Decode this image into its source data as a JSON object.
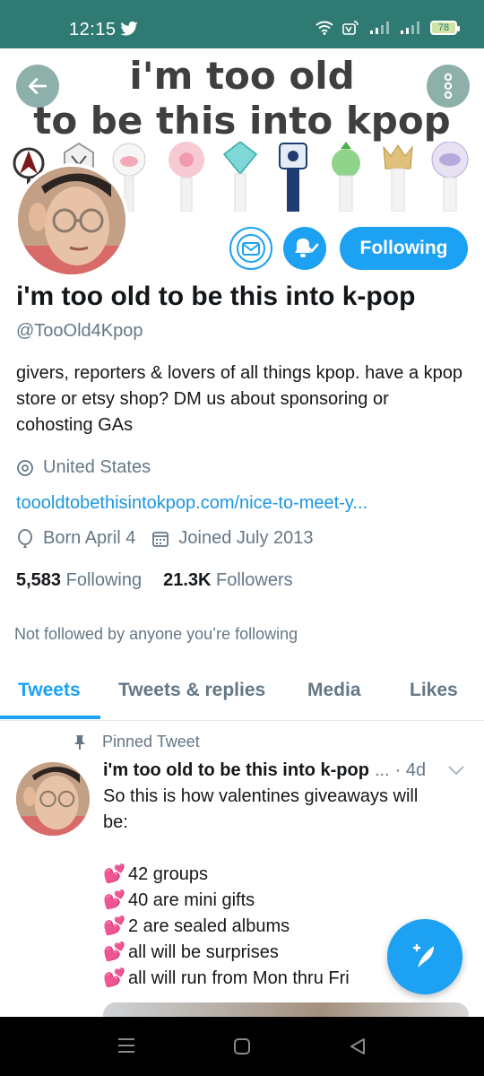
{
  "status_bar": {
    "time": "12:15",
    "battery": "78",
    "icons": [
      "twitter-bird-icon",
      "wifi-icon",
      "volte-icon",
      "signal-icon",
      "signal-icon",
      "battery-icon"
    ]
  },
  "header": {
    "title_line1": "i'm too old",
    "title_line2": "to be this into kpop",
    "back_icon": "arrow-left-icon",
    "more_icon": "more-vertical-icon",
    "lightstick_count": 10
  },
  "profile": {
    "name": "i'm too old to be this into k-pop",
    "handle": "@TooOld4Kpop",
    "bio": "givers, reporters & lovers of all things kpop. have a kpop store or etsy shop? DM us about sponsoring or cohosting GAs",
    "location": "United States",
    "website": "toooldtobethisintokpop.com/nice-to-meet-y...",
    "born": "Born April 4",
    "joined": "Joined July 2013",
    "following_count": "5,583",
    "following_label": "Following",
    "followers_count": "21.3K",
    "followers_label": "Followers",
    "not_followed": "Not followed by anyone you’re following"
  },
  "actions": {
    "follow_label": "Following",
    "message_icon": "envelope-icon",
    "notify_icon": "bell-check-icon"
  },
  "tabs": [
    {
      "label": "Tweets",
      "active": true
    },
    {
      "label": "Tweets & replies",
      "active": false
    },
    {
      "label": "Media",
      "active": false
    },
    {
      "label": "Likes",
      "active": false
    }
  ],
  "pinned_tweet": {
    "pinned_label": "Pinned Tweet",
    "author": "i'm too old to be this into k-pop",
    "ellipsis": "...",
    "time": "· 4d",
    "intro_line1": "So this is how valentines giveaways will",
    "intro_line2": "be:",
    "items": [
      "42 groups",
      "40 are mini gifts",
      "2 are sealed albums",
      "all will be surprises",
      "all will run from Mon thru Fri"
    ],
    "bullet": "💕"
  },
  "colors": {
    "accent": "#1da1f2",
    "status_bar": "#2f7a72",
    "secondary_text": "#657786",
    "link": "#1b95e0",
    "heart": "#e0245e"
  }
}
